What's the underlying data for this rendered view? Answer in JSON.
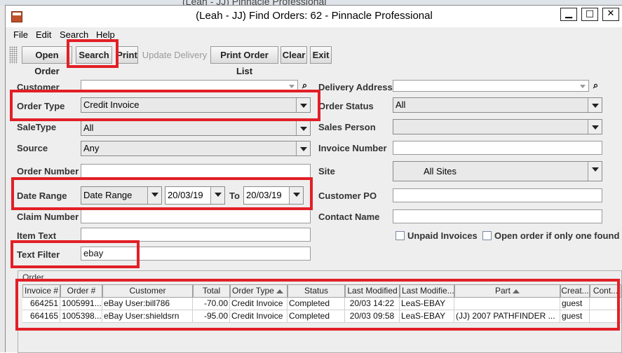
{
  "window": {
    "title": "(Leah - JJ) Find Orders: 62 - Pinnacle Professional"
  },
  "background_window": {
    "title": "(Leah - JJ) Pinnacle Professional"
  },
  "menu": [
    "File",
    "Edit",
    "Search",
    "Help"
  ],
  "toolbar": {
    "open_order": "Open Order",
    "search": "Search",
    "print": "Print",
    "update_delivery": "Update Delivery",
    "print_order_list": "Print Order List",
    "clear": "Clear",
    "exit": "Exit"
  },
  "form": {
    "customer": {
      "label": "Customer",
      "value": ""
    },
    "order_type": {
      "label": "Order Type",
      "value": "Credit Invoice"
    },
    "sale_type": {
      "label": "SaleType",
      "value": "All"
    },
    "source": {
      "label": "Source",
      "value": "Any"
    },
    "order_number": {
      "label": "Order Number",
      "value": ""
    },
    "date_range": {
      "label": "Date Range",
      "mode": "Date Range",
      "from": "20/03/19",
      "to_label": "To",
      "to": "20/03/19"
    },
    "claim_number": {
      "label": "Claim Number",
      "value": ""
    },
    "item_text": {
      "label": "Item Text",
      "value": ""
    },
    "text_filter": {
      "label": "Text Filter",
      "value": "ebay"
    },
    "delivery_address": {
      "label": "Delivery Address",
      "value": ""
    },
    "order_status": {
      "label": "Order Status",
      "value": "All"
    },
    "sales_person": {
      "label": "Sales Person",
      "value": ""
    },
    "invoice_number": {
      "label": "Invoice Number",
      "value": ""
    },
    "site": {
      "label": "Site",
      "value": "All Sites"
    },
    "customer_po": {
      "label": "Customer PO",
      "value": ""
    },
    "contact_name": {
      "label": "Contact Name",
      "value": ""
    },
    "unpaid_invoices": {
      "label": "Unpaid Invoices",
      "checked": false
    },
    "open_if_one": {
      "label": "Open order if only one found",
      "checked": false
    }
  },
  "orders": {
    "title": "Order",
    "columns": [
      "Invoice #",
      "Order #",
      "Customer",
      "Total",
      "Order Type",
      "Status",
      "Last Modified",
      "Last Modifie...",
      "Part",
      "Creat...",
      "Cont..."
    ],
    "rows": [
      [
        "664251",
        "1005991...",
        "eBay User:bill786",
        "-70.00",
        "Credit Invoice",
        "Completed",
        "20/03 14:22",
        "LeaS-EBAY",
        "",
        "guest",
        ""
      ],
      [
        "664165",
        "1005398...",
        "eBay User:shieldsrn",
        "-95.00",
        "Credit Invoice",
        "Completed",
        "20/03 09:58",
        "LeaS-EBAY",
        "(JJ) 2007 PATHFINDER ...",
        "guest",
        ""
      ]
    ]
  },
  "colors": {
    "highlight": "#e21f26",
    "window_bg": "#eeeeee"
  }
}
